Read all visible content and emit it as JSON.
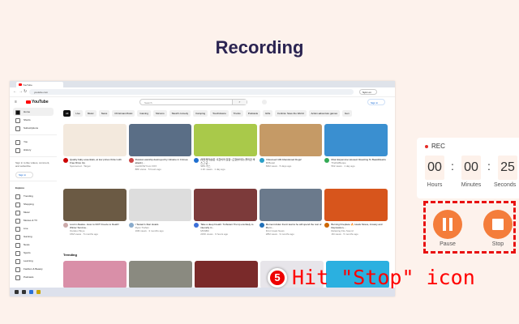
{
  "page_title": "Recording",
  "browser": {
    "tab_title": "YouTube",
    "url": "youtube.com",
    "signed_in": "Sync on"
  },
  "youtube": {
    "logo": "YouTube",
    "search_placeholder": "Search",
    "sign_in": "Sign in",
    "chips": [
      "All",
      "Live",
      "Music",
      "News",
      "Christmas Music",
      "Gaming",
      "Sitcoms",
      "Sketch comedy",
      "Camping",
      "Touchdowns",
      "Trucks",
      "Podcasts",
      "Gifts",
      "Fortnite: Save the World",
      "Action-adventure games",
      "Gen"
    ],
    "sidebar": {
      "top": [
        "Home",
        "Shorts",
        "Subscriptions"
      ],
      "you": [
        "You",
        "History"
      ],
      "signin_text": "Sign in to like videos, comment, and subscribe.",
      "signin_button": "Sign in",
      "explore_heading": "Explore",
      "explore": [
        "Trending",
        "Shopping",
        "Music",
        "Movies & TV",
        "Live",
        "Gaming",
        "News",
        "Sports",
        "Learning",
        "Fashion & Beauty",
        "Podcasts"
      ]
    },
    "rows": [
      [
        {
          "title": "Quality baby essentials, at low prices Order with Free Drive Up.",
          "channel": "Sponsored · Target",
          "stats": "",
          "color": "#f3e9dd",
          "avatar": "#cc0000"
        },
        {
          "title": "Russian warship destroyed by Ukraine in Crimea attack |...",
          "channel": "LiveNOW from FOX",
          "stats": "88K views · 5 hours ago",
          "color": "#5a6e86",
          "avatar": "#c44"
        },
        {
          "title": "[제작제작]날은 '혹한이라 듯함' (고향술리다)-플리만 색스그 근...",
          "channel": "SBS 캐스",
          "stats": "1.1K views · 1 day ago",
          "color": "#a9c94a",
          "avatar": "#1e6fd0"
        },
        {
          "title": "I Rescued 100 Abandoned Dogs!",
          "channel": "MrBeast",
          "stats": "69M views · 5 days ago",
          "color": "#c59a66",
          "avatar": "#2aa0c8"
        },
        {
          "title": "Most Expensive Houses! Reacting To BeastReacts",
          "channel": "TheRelBeque",
          "stats": "562 views · 1 day ago",
          "color": "#3a8fd0",
          "avatar": "#3a5"
        }
      ],
      [
        {
          "title": "Lost in Alaska - How to NOT Freeze to Death! Winter Surviva...",
          "channel": "Outdoor Boys",
          "stats": "15M views · 5 months ago",
          "color": "#6b5a44",
          "avatar": "#caa"
        },
        {
          "title": "I Tested 1-Star Hotels",
          "channel": "Ryan Trahan",
          "stats": "16M views · 3 months ago",
          "color": "#ddd",
          "avatar": "#8ac"
        },
        {
          "title": "Take a deep breath: Turbulent Trump era likely to intensify in...",
          "channel": "MSNBC",
          "stats": "215K views · 6 hours ago",
          "color": "#7c3a3a",
          "avatar": "#3b6fd8"
        },
        {
          "title": "Moment Aiden Fucci learns he will spend the rest of life in...",
          "channel": "First Coast News",
          "stats": "28M views · 9 months ago",
          "color": "#6b7a8c",
          "avatar": "#1f6fb8"
        },
        {
          "title": "Burning Fireplace 🔥 Heals Stress, Anxiety and Depression,...",
          "channel": "Relaxing Fire Sound",
          "stats": "1M views · 5 months ago",
          "color": "#d7551c",
          "avatar": "#c60"
        }
      ]
    ],
    "trending_heading": "Trending",
    "trending_colors": [
      "#d98fa8",
      "#8a8a80",
      "#7a2a2a",
      "#e7e5ea",
      "#2bb0e0"
    ]
  },
  "recorder": {
    "rec_label": "REC",
    "hours": "00",
    "minutes": "00",
    "seconds": "25",
    "hours_label": "Hours",
    "minutes_label": "Minutes",
    "seconds_label": "Seconds",
    "pause_label": "Pause",
    "stop_label": "Stop"
  },
  "annotation": {
    "step": "5",
    "text": "Hit \"Stop\" icon"
  }
}
